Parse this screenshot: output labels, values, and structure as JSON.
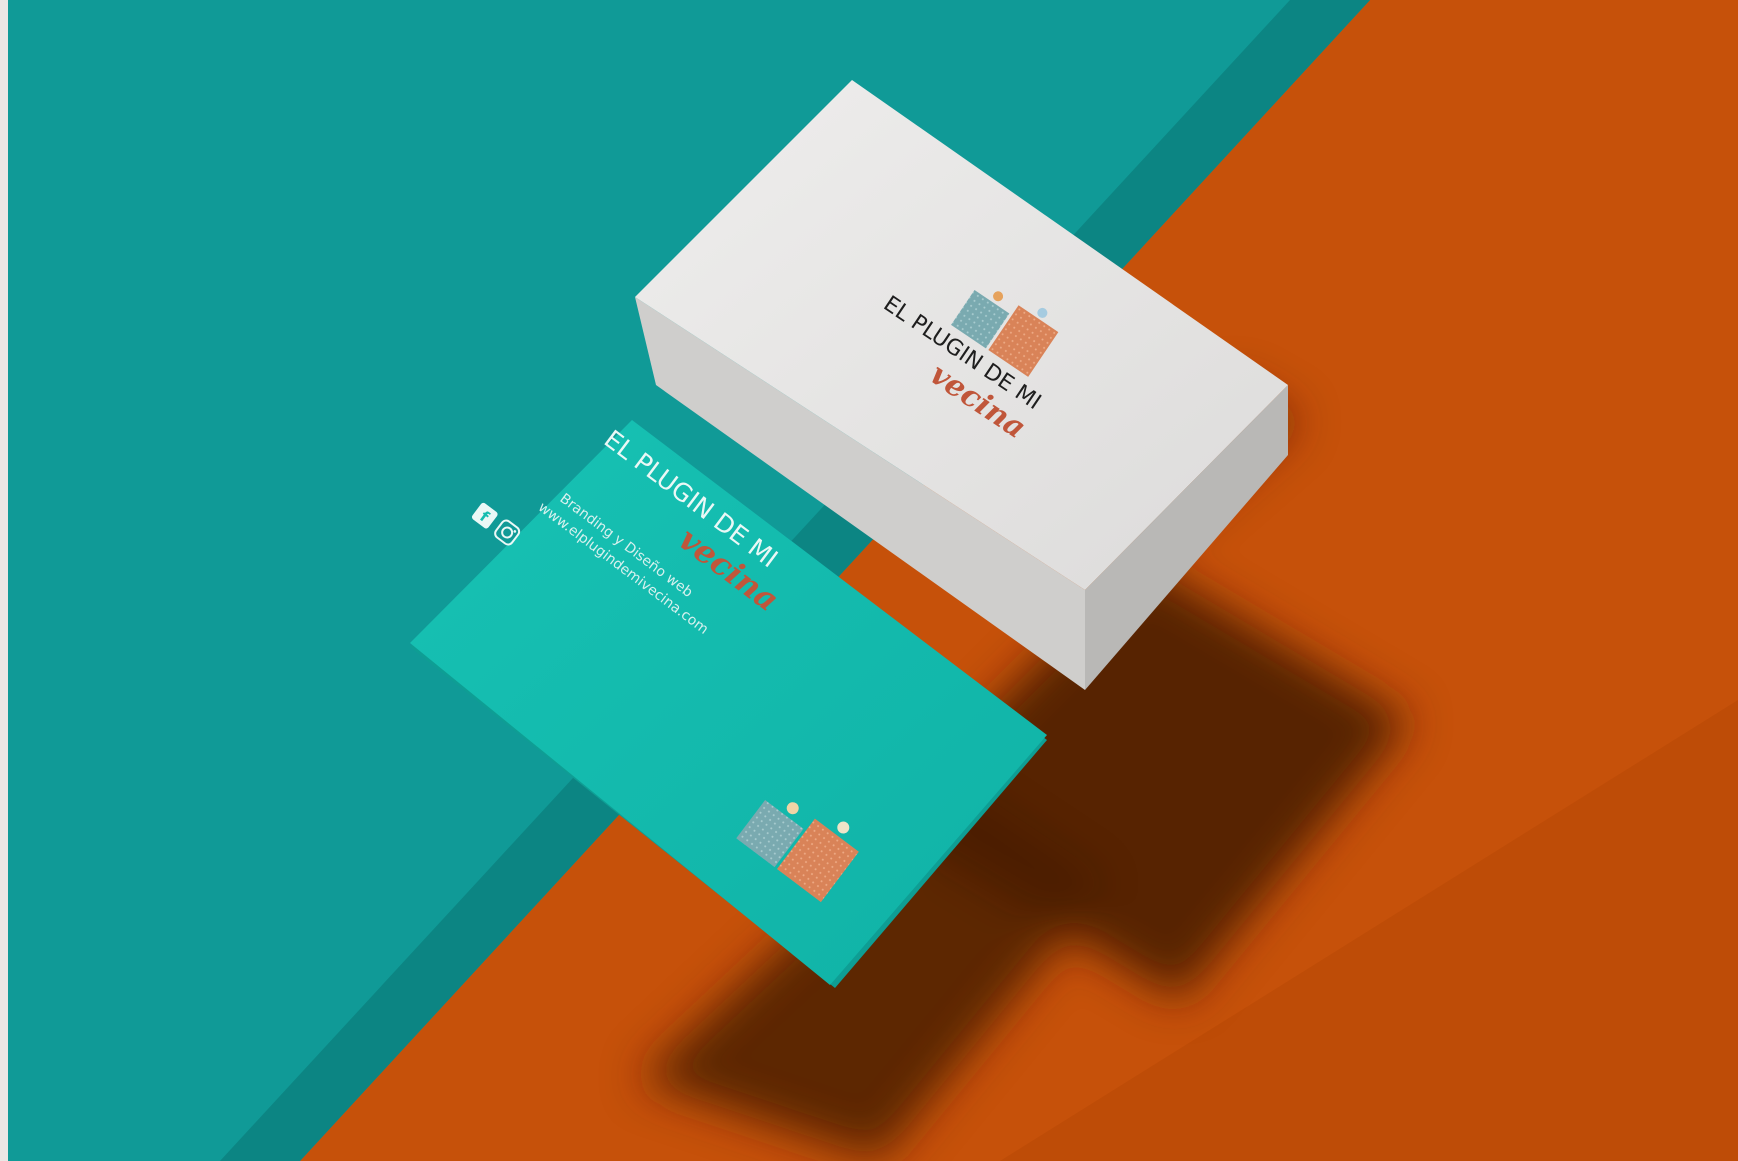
{
  "photo": {
    "colors": {
      "teal_surface": "#109a97",
      "teal_dark": "#0a7775",
      "orange_surface": "#c6510a",
      "orange_shadow": "#4a1d06",
      "card_white": "#e9e8e7",
      "card_side": "#c9c8c6",
      "card_teal": "#13bdb0",
      "logo_blue": "#7aaab0",
      "logo_orange": "#d98358",
      "logo_red": "#c0563a",
      "logo_black": "#1e1e1e"
    },
    "white_card": {
      "brand_line1": "EL PLUGIN DE MI",
      "brand_line2": "vecina",
      "logo": "two-houses-with-figures-logo"
    },
    "teal_card": {
      "brand_line1": "EL PLUGIN DE MI",
      "brand_line2": "vecina",
      "tagline": "Branding y Diseño web",
      "website": "www.elplugindemivecina.com",
      "icons": [
        "facebook-icon",
        "instagram-icon"
      ],
      "logo": "two-houses-with-figures-logo"
    }
  }
}
